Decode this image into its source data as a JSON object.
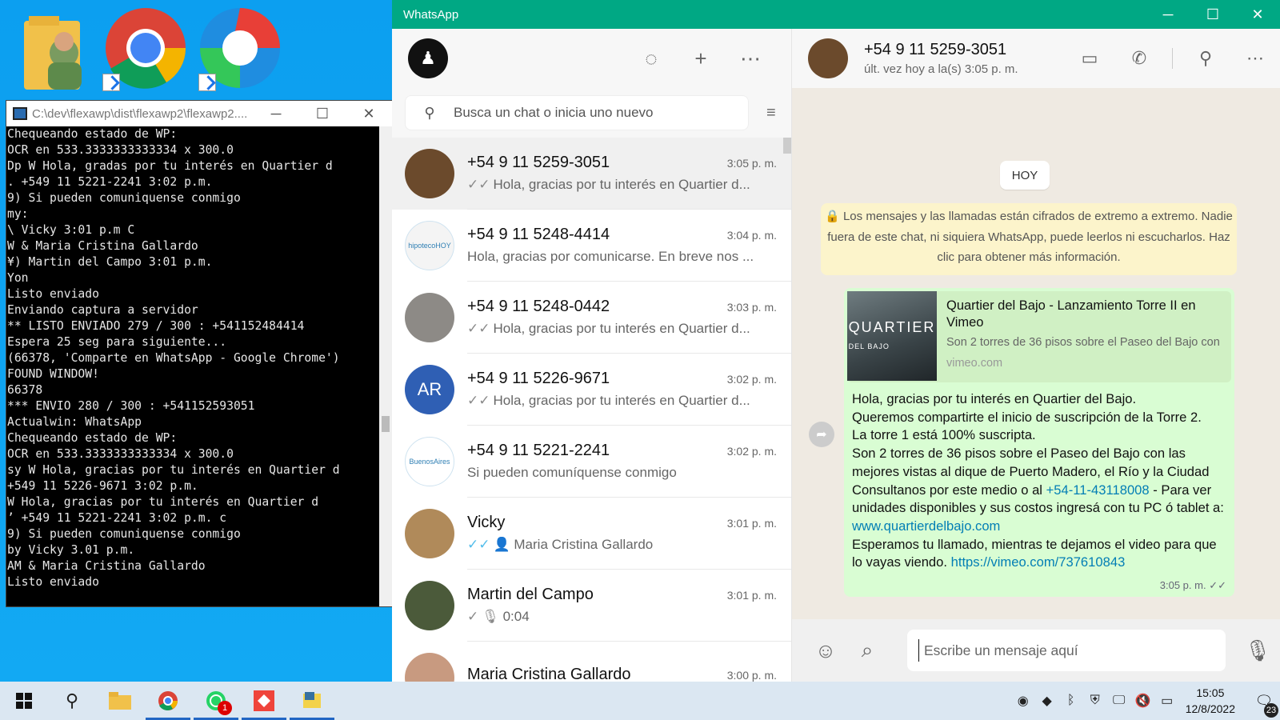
{
  "console": {
    "title": "C:\\dev\\flexawp\\dist\\flexawp2\\flexawp2....",
    "lines": [
      "Chequeando estado de WP:",
      "OCR en 533.3333333333334 x 300.0",
      "Dp W Hola, gradas por tu interés en Quartier d",
      ". +549 11 5221-2241 3:02 p.m.",
      "9) Si pueden comuniquense conmigo",
      "my:",
      "\\ Vicky 3:01 p.m C",
      "W & Maria Cristina Gallardo",
      "¥) Martin del Campo 3:01 p.m.",
      "Yon",
      "Listo enviado",
      "Enviando captura a servidor",
      "** LISTO ENVIADO 279 / 300 : +541152484414",
      "Espera 25 seg para siguiente...",
      "(66378, 'Comparte en WhatsApp - Google Chrome')",
      "FOUND WINDOW!",
      "66378",
      "*** ENVIO 280 / 300 : +541152593051",
      "Actualwin: WhatsApp",
      "Chequeando estado de WP:",
      "OCR en 533.3333333333334 x 300.0",
      "sy W Hola, gracias por tu interés en Quartier d",
      "+549 11 5226-9671 3:02 p.m.",
      "W Hola, gracias por tu interés en Quartier d",
      "’ +549 11 5221-2241 3:02 p.m. c",
      "9) Si pueden comuniquense conmigo",
      "by Vicky 3.01 p.m.",
      "AM & Maria Cristina Gallardo",
      "Listo enviado"
    ]
  },
  "whatsapp": {
    "window_title": "WhatsApp",
    "search_placeholder": "Busca un chat o inicia uno nuevo",
    "chats": [
      {
        "name": "+54 9 11 5259-3051",
        "time": "3:05 p. m.",
        "preview": "Hola, gracias por tu interés en Quartier d...",
        "tick": "read-grey",
        "avatar": "#6b4a2c",
        "initials": ""
      },
      {
        "name": "+54 9 11 5248-4414",
        "time": "3:04 p. m.",
        "preview": "Hola, gracias por comunicarse. En breve nos ...",
        "tick": "",
        "avatar": "#f4f4f4",
        "initials": "hipotecoHOY"
      },
      {
        "name": "+54 9 11 5248-0442",
        "time": "3:03 p. m.",
        "preview": "Hola, gracias por tu interés en Quartier d...",
        "tick": "read-grey",
        "avatar": "#8d8a86",
        "initials": ""
      },
      {
        "name": "+54 9 11 5226-9671",
        "time": "3:02 p. m.",
        "preview": "Hola, gracias por tu interés en Quartier d...",
        "tick": "read-grey",
        "avatar": "#2f5fb4",
        "initials": "AR"
      },
      {
        "name": "+54 9 11 5221-2241",
        "time": "3:02 p. m.",
        "preview": "Si pueden comuníquense conmigo",
        "tick": "",
        "avatar": "#ffffff",
        "initials": "BuenosAires"
      },
      {
        "name": "Vicky",
        "time": "3:01 p. m.",
        "preview": "Maria Cristina Gallardo",
        "tick": "read-blue",
        "avatar": "#b08a5a",
        "initials": ""
      },
      {
        "name": "Martin del Campo",
        "time": "3:01 p. m.",
        "preview": "0:04",
        "tick": "sent",
        "avatar": "#4b5a3a",
        "initials": ""
      },
      {
        "name": "Maria Cristina Gallardo",
        "time": "3:00 p. m.",
        "preview": "",
        "tick": "",
        "avatar": "#c89a80",
        "initials": ""
      }
    ],
    "active_chat": {
      "name": "+54 9 11 5259-3051",
      "status": "últ. vez hoy a la(s) 3:05 p. m.",
      "day_chip": "HOY",
      "encryption_notice": "Los mensajes y las llamadas están cifrados de extremo a extremo. Nadie fuera de este chat, ni siquiera WhatsApp, puede leerlos ni escucharlos. Haz clic para obtener más información.",
      "link_preview": {
        "title": "Quartier del Bajo - Lanzamiento Torre II en Vimeo",
        "description": "Son 2 torres de 36 pisos sobre el Paseo del Bajo con",
        "domain": "vimeo.com",
        "thumb_text": "QUARTIER",
        "thumb_sub": "DEL BAJO"
      },
      "message": {
        "l1": "Hola, gracias por tu interés en Quartier del Bajo.",
        "l2": "Queremos compartirte el inicio de suscripción de la Torre 2.",
        "l3": "La torre 1 está 100% suscripta.",
        "l4": "Son 2 torres de 36 pisos sobre el Paseo del Bajo con las mejores vistas al dique de Puerto Madero, el Río y la Ciudad",
        "l5a": "Consultanos por este medio o al ",
        "phone": "+54-11-43118008",
        "l5b": " - Para ver unidades disponibles y sus costos ingresá con tu PC ó tablet a: ",
        "site": "www.quartierdelbajo.com",
        "l6": "Esperamos tu llamado, mientras te dejamos el video para que lo vayas viendo. ",
        "video": "https://vimeo.com/737610843",
        "time": "3:05 p. m."
      },
      "composer_placeholder": "Escribe un mensaje aquí"
    }
  },
  "taskbar": {
    "whatsapp_badge": "1",
    "time": "15:05",
    "date": "12/8/2022",
    "notifications": "23"
  },
  "colors": {
    "whatsapp_green": "#00a884",
    "bubble": "#d9fdd3",
    "link": "#027eb5",
    "desktop": "#10a4ec"
  }
}
